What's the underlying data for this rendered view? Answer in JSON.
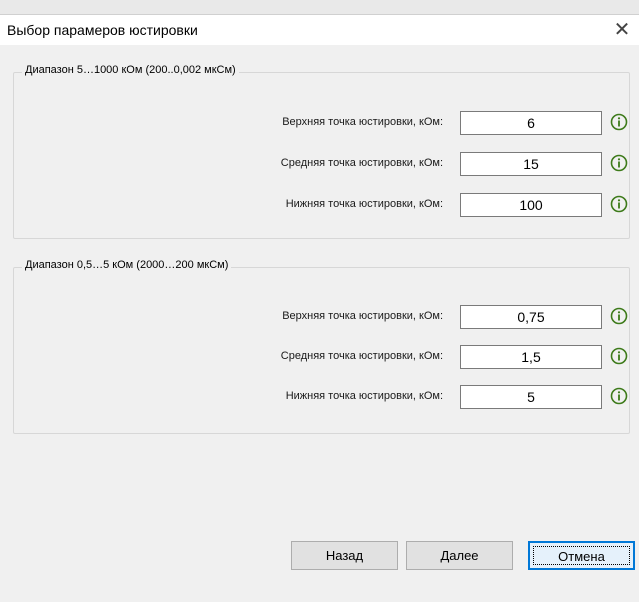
{
  "window": {
    "title": "Выбор парамеров юстировки",
    "close_glyph": "✕"
  },
  "groups": [
    {
      "title": "Диапазон 5…1000 кОм (200..0,002 мкСм)",
      "rows": [
        {
          "label": "Верхняя точка юстировки, кОм:",
          "value": "6",
          "icon": "info-icon"
        },
        {
          "label": "Средняя точка юстировки, кОм:",
          "value": "15",
          "icon": "info-icon"
        },
        {
          "label": "Нижняя точка юстировки, кОм:",
          "value": "100",
          "icon": "info-icon"
        }
      ]
    },
    {
      "title": "Диапазон 0,5…5 кОм (2000…200 мкСм)",
      "rows": [
        {
          "label": "Верхняя точка юстировки, кОм:",
          "value": "0,75",
          "icon": "info-icon"
        },
        {
          "label": "Средняя точка юстировки, кОм:",
          "value": "1,5",
          "icon": "info-icon"
        },
        {
          "label": "Нижняя точка юстировки, кОм:",
          "value": "5",
          "icon": "info-icon"
        }
      ]
    }
  ],
  "buttons": {
    "back": "Назад",
    "next": "Далее",
    "cancel": "Отмена"
  },
  "colors": {
    "info_icon": "#3d7a1a",
    "default_button_border": "#0078d7"
  }
}
